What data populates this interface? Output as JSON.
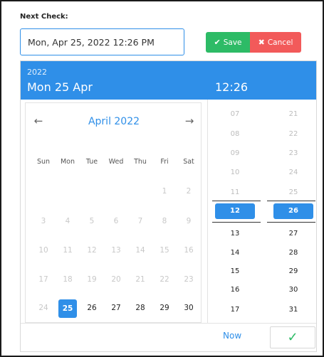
{
  "form": {
    "label": "Next Check:",
    "input_value": "Mon, Apr 25, 2022 12:26 PM"
  },
  "actions": {
    "save_label": "Save",
    "save_glyph": "✔",
    "cancel_label": "Cancel",
    "cancel_glyph": "✖"
  },
  "picker": {
    "header": {
      "year": "2022",
      "date": "Mon 25 Apr",
      "time": "12:26"
    },
    "calendar": {
      "prev_glyph": "←",
      "next_glyph": "→",
      "month_title": "April 2022",
      "weekdays": [
        "Sun",
        "Mon",
        "Tue",
        "Wed",
        "Thu",
        "Fri",
        "Sat"
      ],
      "weeks": [
        [
          {
            "d": "",
            "m": true
          },
          {
            "d": "",
            "m": true
          },
          {
            "d": "",
            "m": true
          },
          {
            "d": "",
            "m": true
          },
          {
            "d": "",
            "m": true
          },
          {
            "d": "1",
            "m": true
          },
          {
            "d": "2",
            "m": true
          }
        ],
        [
          {
            "d": "3",
            "m": true
          },
          {
            "d": "4",
            "m": true
          },
          {
            "d": "5",
            "m": true
          },
          {
            "d": "6",
            "m": true
          },
          {
            "d": "7",
            "m": true
          },
          {
            "d": "8",
            "m": true
          },
          {
            "d": "9",
            "m": true
          }
        ],
        [
          {
            "d": "10",
            "m": true
          },
          {
            "d": "11",
            "m": true
          },
          {
            "d": "12",
            "m": true
          },
          {
            "d": "13",
            "m": true
          },
          {
            "d": "14",
            "m": true
          },
          {
            "d": "15",
            "m": true
          },
          {
            "d": "16",
            "m": true
          }
        ],
        [
          {
            "d": "17",
            "m": true
          },
          {
            "d": "18",
            "m": true
          },
          {
            "d": "19",
            "m": true
          },
          {
            "d": "20",
            "m": true
          },
          {
            "d": "21",
            "m": true
          },
          {
            "d": "22",
            "m": true
          },
          {
            "d": "23",
            "m": true
          }
        ],
        [
          {
            "d": "24",
            "m": true
          },
          {
            "d": "25",
            "s": true
          },
          {
            "d": "26"
          },
          {
            "d": "27"
          },
          {
            "d": "28"
          },
          {
            "d": "29"
          },
          {
            "d": "30"
          }
        ]
      ]
    },
    "hours": [
      {
        "v": "07",
        "muted": true
      },
      {
        "v": "08",
        "muted": true
      },
      {
        "v": "09",
        "muted": true
      },
      {
        "v": "10",
        "muted": true
      },
      {
        "v": "11",
        "muted": true
      },
      {
        "v": "12",
        "selected": true
      },
      {
        "v": "13"
      },
      {
        "v": "14"
      },
      {
        "v": "15"
      },
      {
        "v": "16"
      },
      {
        "v": "17"
      }
    ],
    "minutes": [
      {
        "v": "21",
        "muted": true
      },
      {
        "v": "22",
        "muted": true
      },
      {
        "v": "23",
        "muted": true
      },
      {
        "v": "24",
        "muted": true
      },
      {
        "v": "25",
        "muted": true
      },
      {
        "v": "26",
        "selected": true
      },
      {
        "v": "27"
      },
      {
        "v": "28"
      },
      {
        "v": "29"
      },
      {
        "v": "30"
      },
      {
        "v": "31"
      }
    ],
    "footer": {
      "now_label": "Now",
      "ok_glyph": "✓"
    }
  },
  "colors": {
    "accent": "#2f8fe8",
    "save": "#2dbb66",
    "cancel": "#f25a5a"
  }
}
